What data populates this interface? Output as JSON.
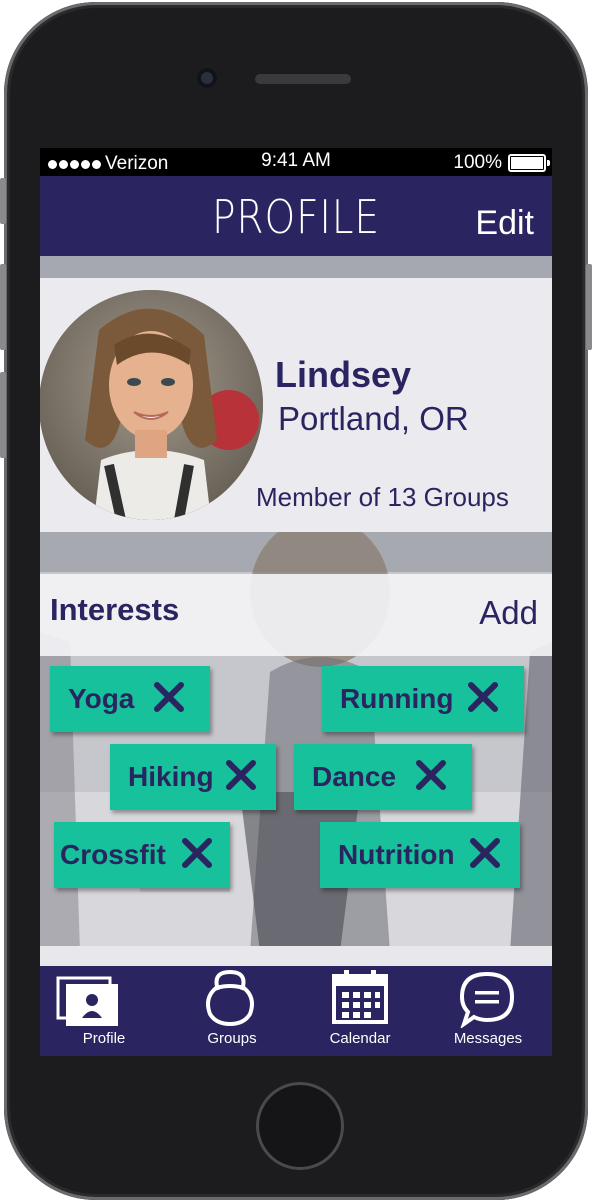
{
  "status_bar": {
    "carrier": "Verizon",
    "time": "9:41 AM",
    "battery": "100%"
  },
  "header": {
    "title": "PROFILE",
    "edit_label": "Edit"
  },
  "profile": {
    "name": "Lindsey",
    "location": "Portland, OR",
    "membership": "Member of 13 Groups"
  },
  "interests": {
    "title": "Interests",
    "add_label": "Add",
    "items": [
      {
        "label": "Yoga"
      },
      {
        "label": "Running"
      },
      {
        "label": "Hiking"
      },
      {
        "label": "Dance"
      },
      {
        "label": "Crossfit"
      },
      {
        "label": "Nutrition"
      }
    ]
  },
  "tabbar": {
    "items": [
      {
        "label": "Profile",
        "icon": "profile-icon"
      },
      {
        "label": "Groups",
        "icon": "kettlebell-icon"
      },
      {
        "label": "Calendar",
        "icon": "calendar-icon"
      },
      {
        "label": "Messages",
        "icon": "messages-icon"
      }
    ]
  },
  "colors": {
    "primary": "#2a2560",
    "chip": "#16c19b",
    "card": "#ebebef"
  }
}
